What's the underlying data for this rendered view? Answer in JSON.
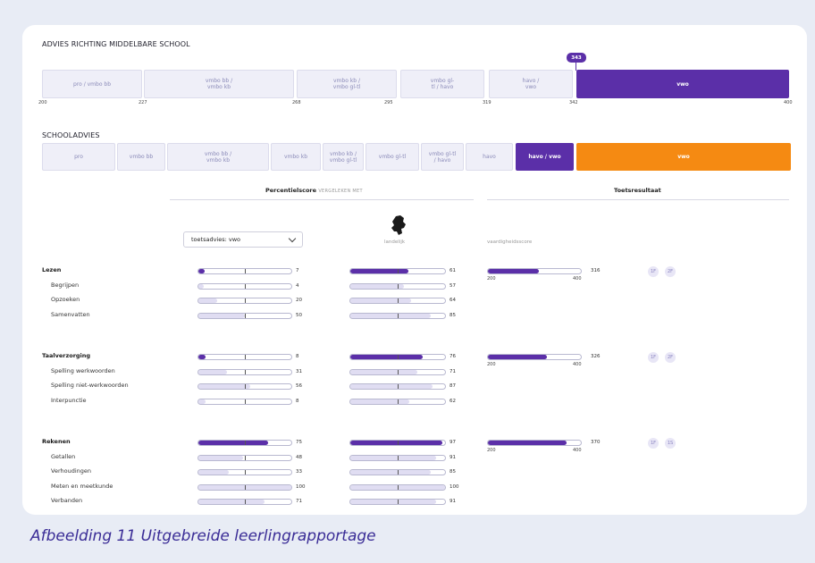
{
  "section1": {
    "title": "ADVIES RICHTING MIDDELBARE SCHOOL",
    "segments": [
      "pro / vmbo bb",
      "vmbo bb /\nvmbo kb",
      "vmbo kb /\nvmbo gl-tl",
      "vmbo gl-\ntl / havo",
      "havo /\nvwo",
      "vwo"
    ],
    "active_index": 5,
    "ticks": [
      "200",
      "227",
      "268",
      "295",
      "319",
      "342",
      "400"
    ],
    "score": "343"
  },
  "section2": {
    "title": "SCHOOLADVIES",
    "segments": [
      "pro",
      "vmbo bb",
      "vmbo bb /\nvmbo kb",
      "vmbo kb",
      "vmbo kb /\nvmbo gl-tl",
      "vmbo gl-tl",
      "vmbo gl-tl\n/ havo",
      "havo",
      "havo / vwo",
      "vwo"
    ],
    "active_index": 8,
    "orange_index": 9
  },
  "table": {
    "percentile_header": "Percentielscore",
    "percentile_sub": "VERGELEKEN MET",
    "toets_header": "Toetsresultaat",
    "dropdown_value": "toetsadvies: vwo",
    "landelijk_label": "landelijk",
    "vaardigheid_label": "vaardigheidsscore"
  },
  "groups": [
    {
      "name": "Lezen",
      "main": {
        "p1": 7,
        "p2": 61
      },
      "subs": [
        {
          "name": "Begrijpen",
          "p1": 4,
          "p2": 57
        },
        {
          "name": "Opzoeken",
          "p1": 20,
          "p2": 64
        },
        {
          "name": "Samenvatten",
          "p1": 50,
          "p2": 85
        }
      ],
      "score": {
        "value": "316",
        "fill": 0.55,
        "min": "200",
        "max": "400"
      },
      "badges": [
        "1F",
        "2F"
      ]
    },
    {
      "name": "Taalverzorging",
      "main": {
        "p1": 8,
        "p2": 76
      },
      "subs": [
        {
          "name": "Spelling werkwoorden",
          "p1": 31,
          "p2": 71
        },
        {
          "name": "Spelling niet-werkwoorden",
          "p1": 56,
          "p2": 87
        },
        {
          "name": "Interpunctie",
          "p1": 8,
          "p2": 62
        }
      ],
      "score": {
        "value": "326",
        "fill": 0.63,
        "min": "200",
        "max": "400"
      },
      "badges": [
        "1F",
        "2F"
      ]
    },
    {
      "name": "Rekenen",
      "main": {
        "p1": 75,
        "p2": 97
      },
      "subs": [
        {
          "name": "Getallen",
          "p1": 48,
          "p2": 91
        },
        {
          "name": "Verhoudingen",
          "p1": 33,
          "p2": 85
        },
        {
          "name": "Meten en meetkunde",
          "p1": 100,
          "p2": 100
        },
        {
          "name": "Verbanden",
          "p1": 71,
          "p2": 91
        }
      ],
      "score": {
        "value": "370",
        "fill": 0.85,
        "min": "200",
        "max": "400"
      },
      "badges": [
        "1F",
        "1S"
      ]
    }
  ],
  "caption": "Afbeelding 11 Uitgebreide leerlingrapportage",
  "colors": {
    "purple": "#5b2fa8",
    "orange": "#f58a12",
    "caption": "#3a2c96"
  }
}
